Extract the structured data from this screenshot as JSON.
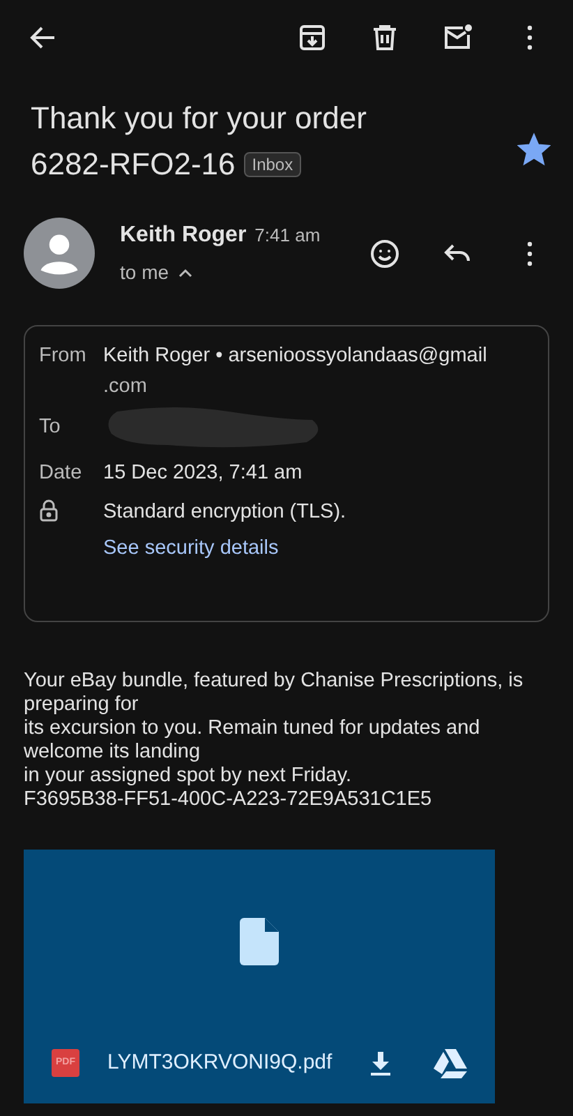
{
  "subject": {
    "title": "Thank you for your order",
    "order": "6282-RFO2-16",
    "label": "Inbox",
    "starred": true
  },
  "sender": {
    "name": "Keith Roger",
    "time": "7:41 am",
    "recipient": "to me",
    "expanded": true
  },
  "details": [
    {
      "kind": "from",
      "label": "From",
      "value": "Keith Roger • arsenioossyolandaas@gmail",
      "value2": ".com"
    },
    {
      "kind": "to",
      "label": "To"
    },
    {
      "kind": "date",
      "label": "Date",
      "value": "15 Dec 2023, 7:41 am"
    },
    {
      "kind": "security",
      "value": "Standard encryption (TLS).",
      "link": "See security details"
    }
  ],
  "body": [
    "Your eBay bundle, featured by Chanise Prescriptions, is preparing for",
    "its excursion to you. Remain tuned for updates and welcome its landing",
    "in your assigned spot by next Friday.",
    "F3695B38-FF51-400C-A223-72E9A531C1E5"
  ],
  "attachment": {
    "badge": "PDF",
    "filename": "LYMT3OKRVONI9Q.pdf"
  }
}
